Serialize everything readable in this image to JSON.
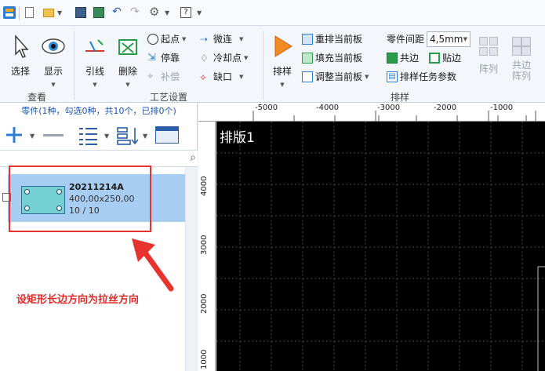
{
  "ribbon": {
    "view_group": {
      "label": "查看",
      "select": "选择",
      "show": "显示"
    },
    "process_group": {
      "label": "工艺设置",
      "lead": "引线",
      "delete": "删除",
      "start_point": "起点",
      "stop": "停靠",
      "compensate": "补偿",
      "micro_joint": "微连",
      "cooling_point": "冷却点",
      "notch": "缺口"
    },
    "nest_group": {
      "label": "排样",
      "nest": "排样",
      "renest_board": "重排当前板",
      "fill_board": "填充当前板",
      "adjust_board": "调整当前板",
      "part_spacing_label": "零件间距",
      "part_spacing_value": "4,5mm",
      "common_edge": "共边",
      "stick_edge": "贴边",
      "task_params": "排样任务参数",
      "array": "阵列",
      "common_array": "共边\n阵列"
    }
  },
  "panel": {
    "header": "零件(1种，勾选0种，共10个，已排0个)",
    "items": [
      {
        "name": "20211214A",
        "size": "400,00x250,00",
        "count": "10 / 10"
      }
    ]
  },
  "annotation": {
    "note": "设矩形长边方向为拉丝方向"
  },
  "canvas": {
    "board_name": "排版1",
    "h_ticks": [
      "-5000",
      "-4000",
      "-3000",
      "-2000",
      "-1000"
    ],
    "v_ticks": [
      "4000",
      "3000",
      "2000",
      "1000"
    ]
  },
  "colors": {
    "accent": "#1a56b3",
    "annotation": "#e8322d",
    "selection": "#a8cdf2"
  }
}
